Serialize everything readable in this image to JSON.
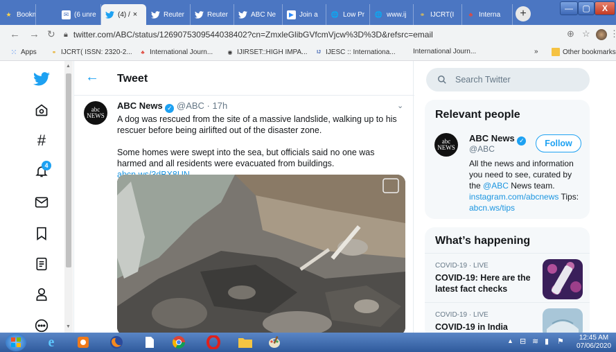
{
  "browser": {
    "tabs": [
      {
        "label": "Bookm",
        "icon": "star-icon"
      },
      {
        "label": "(6 unre",
        "icon": "mail-icon"
      },
      {
        "label": "(4) / ",
        "icon": "twitter-icon",
        "active": true,
        "close": "×"
      },
      {
        "label": "Reuter",
        "icon": "twitter-icon"
      },
      {
        "label": "Reuter",
        "icon": "twitter-icon"
      },
      {
        "label": "ABC Ne",
        "icon": "twitter-icon"
      },
      {
        "label": "Join a",
        "icon": "zoom-icon"
      },
      {
        "label": "Low Pr",
        "icon": "globe-icon"
      },
      {
        "label": "www.ij",
        "icon": "globe-icon"
      },
      {
        "label": "IJCRT(I",
        "icon": "ijcrt-icon"
      },
      {
        "label": "Interna",
        "icon": "journal-icon"
      }
    ],
    "new_tab": "+",
    "window_controls": {
      "minimize": "—",
      "maximize": "▢",
      "close": "X"
    },
    "url": "twitter.com/ABC/status/1269075309544038402?cn=ZmxleGlibGVfcmVjcw%3D%3D&refsrc=email",
    "bookmarks": [
      {
        "label": "Apps",
        "icon": "apps-grid-icon"
      },
      {
        "label": "IJCRT( ISSN: 2320-2...",
        "icon": "ijcrt-icon"
      },
      {
        "label": "International Journ...",
        "icon": "journal-icon"
      },
      {
        "label": "IJIRSET::HIGH IMPA...",
        "icon": "globe-icon"
      },
      {
        "label": "IJESC :: Internationa...",
        "icon": "ijesc-icon"
      },
      {
        "label": "International Journ...",
        "icon": ""
      }
    ],
    "bookmarks_more": "»",
    "other_bookmarks": "Other bookmarks"
  },
  "page": {
    "header_title": "Tweet",
    "tweet": {
      "author": "ABC News",
      "handle_time": "@ABC · 17h",
      "avatar_text": "abc NEWS",
      "text1": "A dog was rescued from the site of a massive landslide, walking up to his rescuer before being airlifted out of the disaster zone.",
      "text2": "Some homes were swept into the sea, but officials said no one was harmed and all residents were evacuated from buildings.",
      "link": "abcn.ws/3dBX8UN"
    },
    "notifications_badge": "4",
    "search_placeholder": "Search Twitter",
    "relevant": {
      "title": "Relevant people",
      "name": "ABC News",
      "handle": "@ABC",
      "follow": "Follow",
      "bio1": "All the news and information you need to see, curated by the ",
      "bio_mention": "@ABC",
      "bio2": " News team. ",
      "bio_link1": "instagram.com/abcnews",
      "bio3": " Tips: ",
      "bio_link2": "abcn.ws/tips"
    },
    "happening": {
      "title": "What’s happening",
      "items": [
        {
          "meta": "COVID-19 · LIVE",
          "headline": "COVID-19: Here are the latest fact checks"
        },
        {
          "meta": "COVID-19 · LIVE",
          "headline": "COVID-19 in India"
        }
      ]
    }
  },
  "taskbar": {
    "time": "12:45 AM",
    "date": "07/06/2020"
  },
  "colors": {
    "twitter_blue": "#1da1f2",
    "text": "#14171a",
    "secondary": "#657786"
  }
}
